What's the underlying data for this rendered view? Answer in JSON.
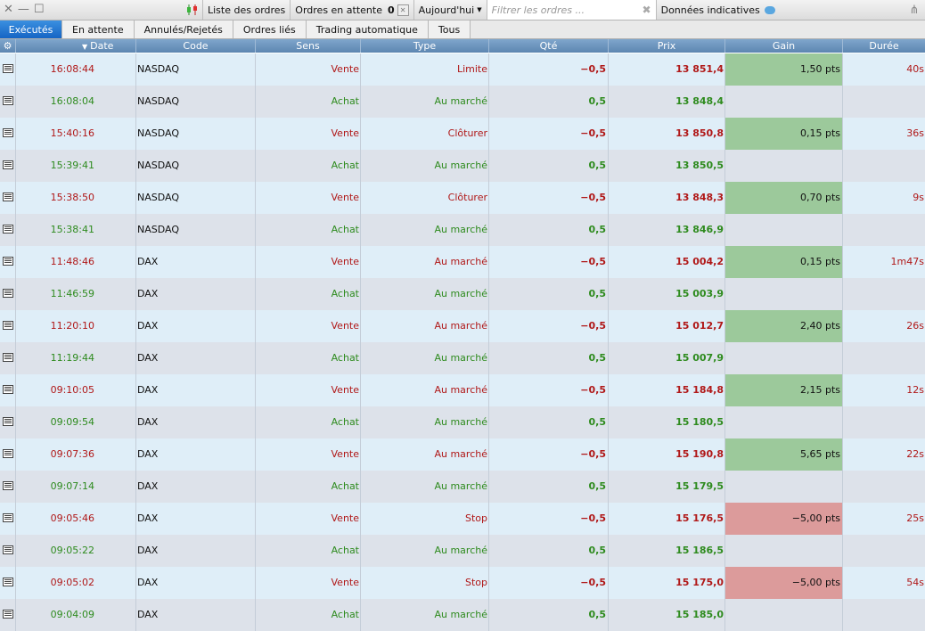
{
  "toolbar": {
    "orders_list": "Liste des ordres",
    "pending_label": "Ordres en attente",
    "pending_count": "0",
    "period": "Aujourd'hui",
    "filter_placeholder": "Filtrer les ordres ...",
    "indicative_data": "Données indicatives"
  },
  "tabs": [
    "Exécutés",
    "En attente",
    "Annulés/Rejetés",
    "Ordres liés",
    "Trading automatique",
    "Tous"
  ],
  "columns": [
    "Date",
    "Code",
    "Sens",
    "Type",
    "Qté",
    "Prix",
    "Gain",
    "Durée"
  ],
  "rows": [
    {
      "date": "16:08:44",
      "code": "NASDAQ",
      "sens": "Vente",
      "type": "Limite",
      "qte": "−0,5",
      "prix": "13 851,4",
      "gain": "1,50 pts",
      "duree": "40s"
    },
    {
      "date": "16:08:04",
      "code": "NASDAQ",
      "sens": "Achat",
      "type": "Au marché",
      "qte": "0,5",
      "prix": "13 848,4",
      "gain": "",
      "duree": ""
    },
    {
      "date": "15:40:16",
      "code": "NASDAQ",
      "sens": "Vente",
      "type": "Clôturer",
      "qte": "−0,5",
      "prix": "13 850,8",
      "gain": "0,15 pts",
      "duree": "36s"
    },
    {
      "date": "15:39:41",
      "code": "NASDAQ",
      "sens": "Achat",
      "type": "Au marché",
      "qte": "0,5",
      "prix": "13 850,5",
      "gain": "",
      "duree": ""
    },
    {
      "date": "15:38:50",
      "code": "NASDAQ",
      "sens": "Vente",
      "type": "Clôturer",
      "qte": "−0,5",
      "prix": "13 848,3",
      "gain": "0,70 pts",
      "duree": "9s"
    },
    {
      "date": "15:38:41",
      "code": "NASDAQ",
      "sens": "Achat",
      "type": "Au marché",
      "qte": "0,5",
      "prix": "13 846,9",
      "gain": "",
      "duree": ""
    },
    {
      "date": "11:48:46",
      "code": "DAX",
      "sens": "Vente",
      "type": "Au marché",
      "qte": "−0,5",
      "prix": "15 004,2",
      "gain": "0,15 pts",
      "duree": "1m47s"
    },
    {
      "date": "11:46:59",
      "code": "DAX",
      "sens": "Achat",
      "type": "Au marché",
      "qte": "0,5",
      "prix": "15 003,9",
      "gain": "",
      "duree": ""
    },
    {
      "date": "11:20:10",
      "code": "DAX",
      "sens": "Vente",
      "type": "Au marché",
      "qte": "−0,5",
      "prix": "15 012,7",
      "gain": "2,40 pts",
      "duree": "26s"
    },
    {
      "date": "11:19:44",
      "code": "DAX",
      "sens": "Achat",
      "type": "Au marché",
      "qte": "0,5",
      "prix": "15 007,9",
      "gain": "",
      "duree": ""
    },
    {
      "date": "09:10:05",
      "code": "DAX",
      "sens": "Vente",
      "type": "Au marché",
      "qte": "−0,5",
      "prix": "15 184,8",
      "gain": "2,15 pts",
      "duree": "12s"
    },
    {
      "date": "09:09:54",
      "code": "DAX",
      "sens": "Achat",
      "type": "Au marché",
      "qte": "0,5",
      "prix": "15 180,5",
      "gain": "",
      "duree": ""
    },
    {
      "date": "09:07:36",
      "code": "DAX",
      "sens": "Vente",
      "type": "Au marché",
      "qte": "−0,5",
      "prix": "15 190,8",
      "gain": "5,65 pts",
      "duree": "22s"
    },
    {
      "date": "09:07:14",
      "code": "DAX",
      "sens": "Achat",
      "type": "Au marché",
      "qte": "0,5",
      "prix": "15 179,5",
      "gain": "",
      "duree": ""
    },
    {
      "date": "09:05:46",
      "code": "DAX",
      "sens": "Vente",
      "type": "Stop",
      "qte": "−0,5",
      "prix": "15 176,5",
      "gain": "−5,00 pts",
      "duree": "25s"
    },
    {
      "date": "09:05:22",
      "code": "DAX",
      "sens": "Achat",
      "type": "Au marché",
      "qte": "0,5",
      "prix": "15 186,5",
      "gain": "",
      "duree": ""
    },
    {
      "date": "09:05:02",
      "code": "DAX",
      "sens": "Vente",
      "type": "Stop",
      "qte": "−0,5",
      "prix": "15 175,0",
      "gain": "−5,00 pts",
      "duree": "54s"
    },
    {
      "date": "09:04:09",
      "code": "DAX",
      "sens": "Achat",
      "type": "Au marché",
      "qte": "0,5",
      "prix": "15 185,0",
      "gain": "",
      "duree": ""
    }
  ]
}
